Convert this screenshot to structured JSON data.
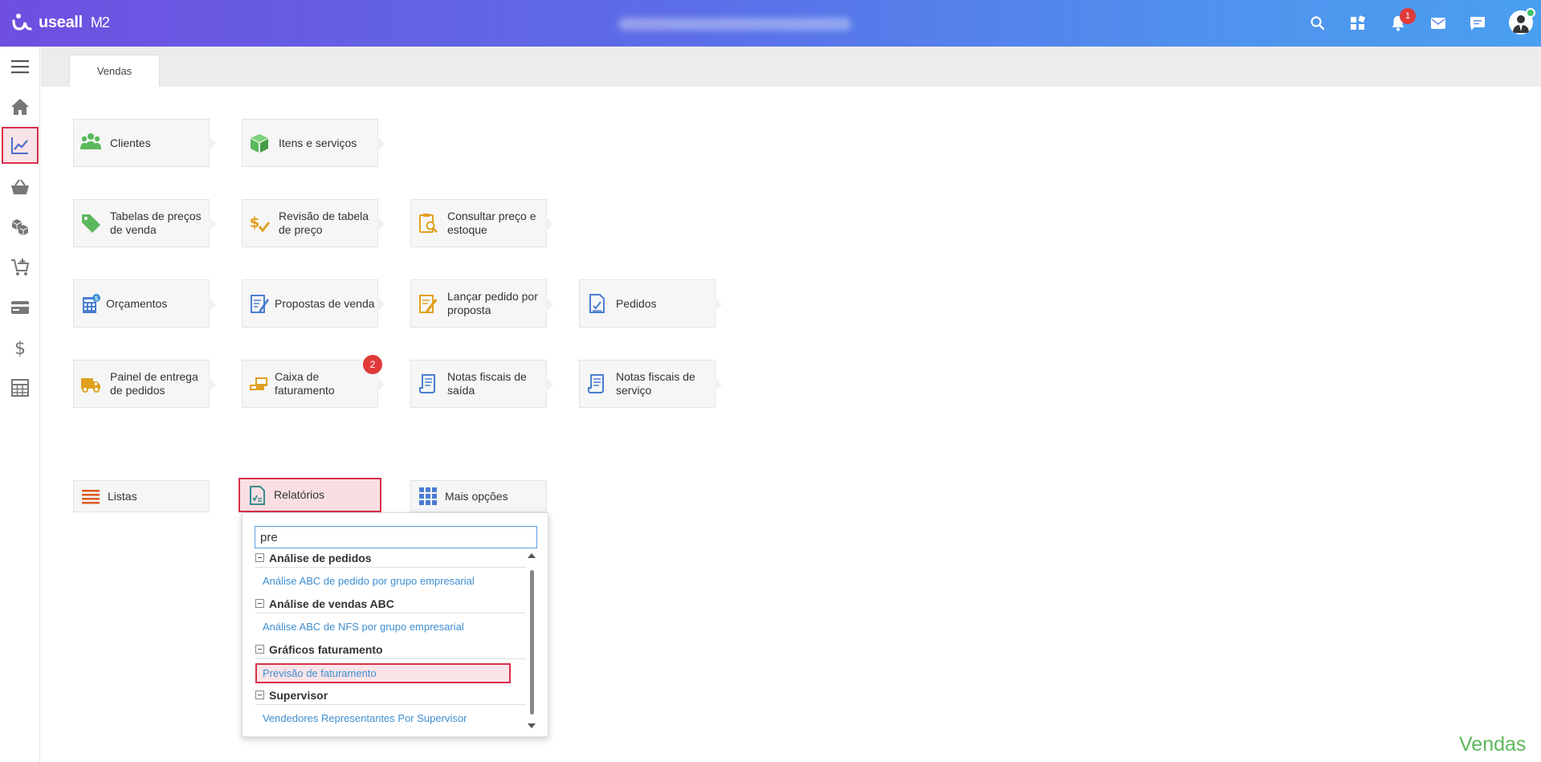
{
  "app": {
    "logo_text": "useall",
    "logo_version": "M2"
  },
  "header": {
    "notification_count": "1"
  },
  "tabs": [
    {
      "label": "Vendas"
    }
  ],
  "tiles": {
    "clientes": "Clientes",
    "itens": "Itens e serviços",
    "tabelas": "Tabelas de preços de venda",
    "revisao": "Revisão de tabela de preço",
    "consultar": "Consultar preço e estoque",
    "orcamentos": "Orçamentos",
    "propostas": "Propostas de venda",
    "lancar": "Lançar pedido por proposta",
    "pedidos": "Pedidos",
    "painel": "Painel de entrega de pedidos",
    "caixa": "Caixa de faturamento",
    "caixa_badge": "2",
    "nf_saida": "Notas fiscais de saída",
    "nf_servico": "Notas fiscais de serviço",
    "listas": "Listas",
    "relatorios": "Relatórios",
    "mais": "Mais opções"
  },
  "dropdown": {
    "search_value": "pre",
    "groups": [
      {
        "title": "Análise de pedidos",
        "items": [
          "Análise ABC de pedido por grupo empresarial"
        ]
      },
      {
        "title": "Análise de vendas ABC",
        "items": [
          "Análise ABC de NFS por grupo empresarial"
        ]
      },
      {
        "title": "Gráficos faturamento",
        "items": [
          "Previsão de faturamento"
        ]
      },
      {
        "title": "Supervisor",
        "items": [
          "Vendedores Representantes Por Supervisor"
        ]
      }
    ]
  },
  "footer_label": "Vendas",
  "colors": {
    "accent": "#d9304a",
    "link": "#3e8ed0",
    "footer": "#5cb85c"
  }
}
